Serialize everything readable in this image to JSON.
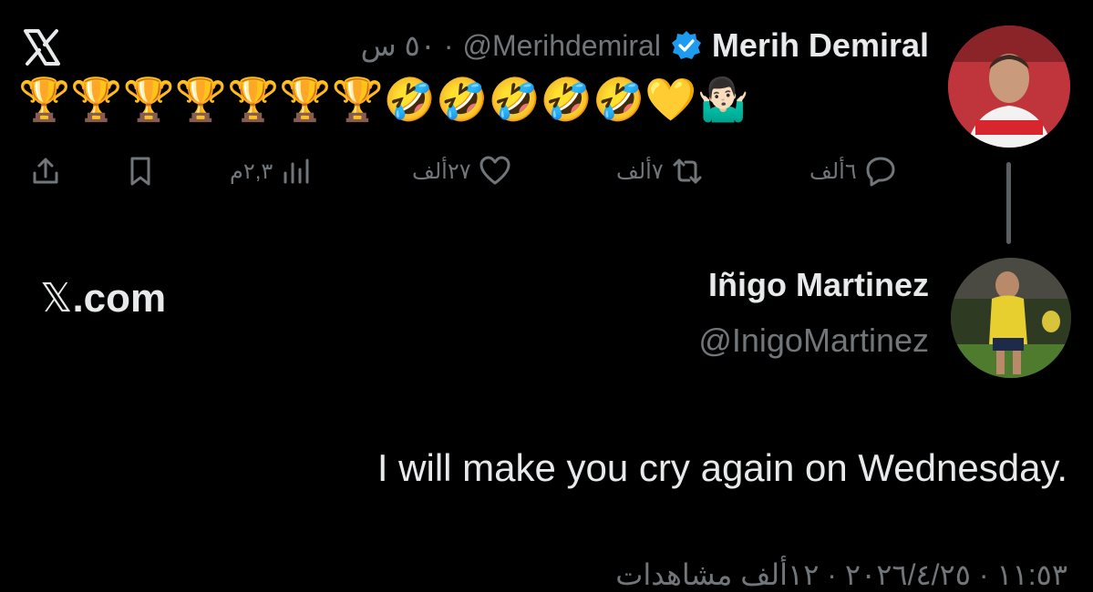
{
  "logo": {
    "icon": "x-logo-icon"
  },
  "tweet": {
    "author_name": "Merih Demiral",
    "author_handle": "@Merihdemiral",
    "time_meta": "٥٠ س ·",
    "verified_icon": "verified-badge-icon",
    "emojis": "🏆🏆🏆🏆🏆🏆🏆🤣🤣🤣🤣🤣💛🤷🏻‍♂️",
    "actions": {
      "share_icon": "share-icon",
      "bookmark_icon": "bookmark-icon",
      "views": "٢,٣م",
      "views_icon": "views-chart-icon",
      "likes": "٢٧ألف",
      "like_icon": "heart-icon",
      "reposts": "٧ألف",
      "repost_icon": "repost-icon",
      "replies": "٦ألف",
      "reply_icon": "reply-bubble-icon"
    }
  },
  "quoted": {
    "site": ".com",
    "site_mark": "𝕏",
    "author_name": "Iñigo Martinez",
    "author_handle": "@InigoMartinez",
    "text": "I will make you cry again on Wednesday.",
    "footer": "١١:٥٣ · ٢٠٢٦/٤/٢٥ · ١٢ألف مشاهدات"
  },
  "colors": {
    "background": "#000000",
    "text": "#e7e9ea",
    "muted": "#71767b",
    "verified": "#1d9bf0"
  }
}
